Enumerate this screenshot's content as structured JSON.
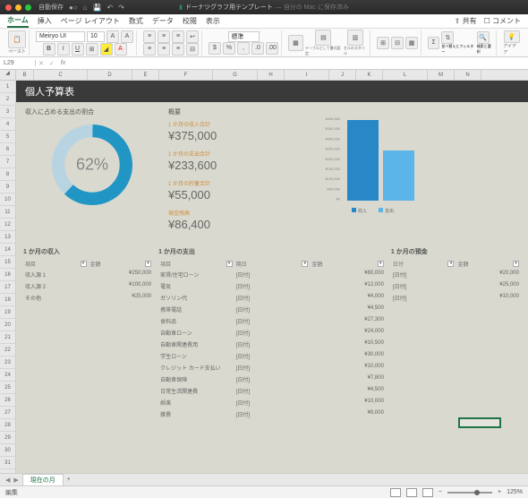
{
  "titlebar": {
    "autosave": "自動保存",
    "filename": "ドーナツグラフ用テンプレート",
    "subtitle": "— 自分の Mac に保存済み"
  },
  "tabs": {
    "home": "ホーム",
    "insert": "挿入",
    "layout": "ページ レイアウト",
    "formulas": "数式",
    "data": "データ",
    "review": "校閲",
    "view": "表示",
    "share": "共有",
    "comment": "コメント"
  },
  "ribbon": {
    "paste": "ペースト",
    "font": "Meiryo UI",
    "size": "10",
    "wrap": "標準",
    "table": "テーブルとして書式設定",
    "cell": "セルのスタイル",
    "sort": "並べ替えとフィルター",
    "find": "検索と選択",
    "idea": "アイデア"
  },
  "namebox": "L29",
  "cols": [
    "B",
    "C",
    "D",
    "E",
    "F",
    "G",
    "H",
    "I",
    "J",
    "K",
    "L",
    "M",
    "N"
  ],
  "doc": {
    "title": "個人予算表",
    "ratio_label": "収入に占める支出の割合",
    "pct": "62%",
    "overview": "概要",
    "kpi": [
      {
        "l": "1 か月の収入合計",
        "v": "¥375,000"
      },
      {
        "l": "1 か月の支出合計",
        "v": "¥233,600"
      },
      {
        "l": "1 か月の貯蓄合計",
        "v": "¥55,000"
      },
      {
        "l": "現金残高",
        "v": "¥86,400"
      }
    ],
    "yaxis": [
      "¥400,000",
      "¥350,000",
      "¥300,000",
      "¥250,000",
      "¥200,000",
      "¥150,000",
      "¥100,000",
      "¥50,000",
      "¥0"
    ],
    "legend": {
      "a": "収入",
      "b": "支出"
    },
    "income": {
      "title": "1 か月の収入",
      "h1": "項目",
      "h2": "金額",
      "rows": [
        [
          "収入源 1",
          "¥250,000"
        ],
        [
          "収入源 2",
          "¥100,000"
        ],
        [
          "その他",
          "¥25,000"
        ]
      ]
    },
    "expense": {
      "title": "1 か月の支出",
      "h1": "項目",
      "h2": "期日",
      "h3": "金額",
      "rows": [
        [
          "家賃/住宅ローン",
          "[日付]",
          "¥80,000"
        ],
        [
          "電気",
          "[日付]",
          "¥12,000"
        ],
        [
          "ガソリン代",
          "[日付]",
          "¥4,000"
        ],
        [
          "携帯電話",
          "[日付]",
          "¥4,500"
        ],
        [
          "食料品",
          "[日付]",
          "¥27,300"
        ],
        [
          "自動車ローン",
          "[日付]",
          "¥24,000"
        ],
        [
          "自動車関連費用",
          "[日付]",
          "¥10,500"
        ],
        [
          "学生ローン",
          "[日付]",
          "¥30,000"
        ],
        [
          "クレジット カード支払い",
          "[日付]",
          "¥10,000"
        ],
        [
          "自動車保険",
          "[日付]",
          "¥7,800"
        ],
        [
          "日常生活関連費",
          "[日付]",
          "¥4,500"
        ],
        [
          "娯楽",
          "[日付]",
          "¥10,000"
        ],
        [
          "雑費",
          "[日付]",
          "¥9,000"
        ]
      ]
    },
    "savings": {
      "title": "1 か月の預金",
      "h1": "日付",
      "h2": "金額",
      "rows": [
        [
          "[日付]",
          "¥20,000"
        ],
        [
          "[日付]",
          "¥25,000"
        ],
        [
          "[日付]",
          "¥10,000"
        ]
      ]
    }
  },
  "chart_data": {
    "type": "bar",
    "categories": [
      "収入",
      "支出"
    ],
    "values": [
      375000,
      233600
    ],
    "ylim": [
      0,
      400000
    ],
    "title": "",
    "xlabel": "",
    "ylabel": ""
  },
  "sheet": {
    "tab": "現在の月",
    "status": "編集",
    "zoom": "125%"
  }
}
